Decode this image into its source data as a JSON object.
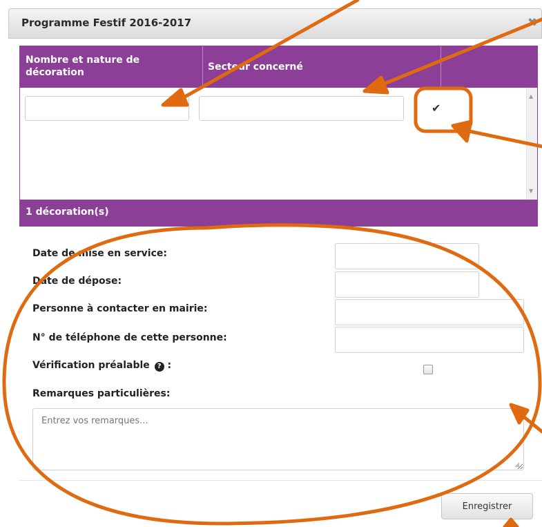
{
  "dialog": {
    "title": "Programme Festif 2016-2017",
    "close_symbol": "✖"
  },
  "table": {
    "columns": [
      {
        "label": "Nombre et nature de décoration"
      },
      {
        "label": "Secteur concerné"
      },
      {
        "label": ""
      }
    ],
    "row_confirm_icon": "check-icon",
    "count_label": "1 décoration(s)"
  },
  "form": {
    "fields": [
      {
        "label": "Date de mise en service:",
        "value": ""
      },
      {
        "label": "Date de dépose:",
        "value": ""
      },
      {
        "label": "Personne à contacter en mairie:",
        "value": ""
      },
      {
        "label": "N° de téléphone de cette personne:",
        "value": ""
      }
    ],
    "verification_label": "Vérification préalable",
    "verification_help_icon": "question-circle-icon",
    "verification_suffix": ":",
    "verification_checked": false,
    "remarks_label": "Remarques particulières:",
    "remarks_placeholder": "Entrez vos remarques..."
  },
  "actions": {
    "save_label": "Enregistrer"
  },
  "annotation_color": "#e06a10"
}
